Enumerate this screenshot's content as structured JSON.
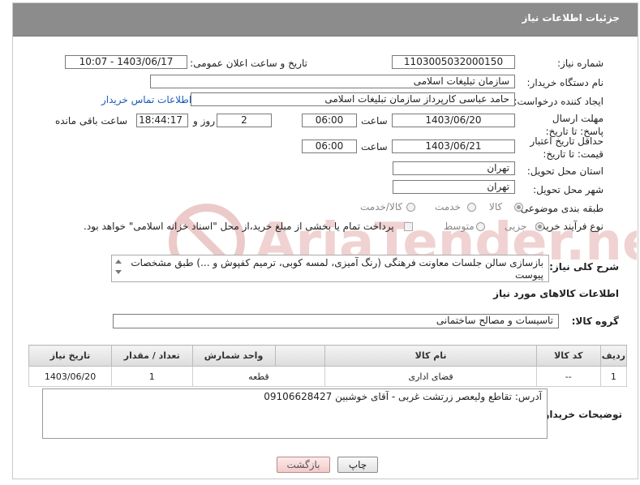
{
  "header": {
    "title": "جزئیات اطلاعات نیاز"
  },
  "fields": {
    "need_number_label": "شماره نیاز:",
    "need_number": "1103005032000150",
    "announce_label": "تاریخ و ساعت اعلان عمومی:",
    "announce_value": "1403/06/17 - 10:07",
    "buyer_org_label": "نام دستگاه خریدار:",
    "buyer_org": "سازمان تبلیغات اسلامی",
    "requester_label": "ایجاد کننده درخواست:",
    "requester": "حامد عباسی کارپرداز سازمان تبلیغات اسلامی",
    "contact_link": "اطلاعات تماس خریدار",
    "deadline_label": "مهلت ارسال پاسخ: تا تاریخ:",
    "deadline_date": "1403/06/20",
    "time_label": "ساعت",
    "deadline_time": "06:00",
    "days_value": "2",
    "days_label": "روز و",
    "remaining_time": "18:44:17",
    "remaining_label": "ساعت باقی مانده",
    "validity_label": "حداقل تاریخ اعتبار قیمت: تا تاریخ:",
    "validity_date": "1403/06/21",
    "validity_time": "06:00",
    "province_label": "استان محل تحویل:",
    "province": "تهران",
    "city_label": "شهر محل تحویل:",
    "city": "تهران",
    "category_label": "طبقه بندی موضوعی:",
    "category_options": [
      "کالا",
      "خدمت",
      "کالا/خدمت"
    ],
    "process_label": "نوع فرآیند خرید :",
    "process_options": [
      "جزیی",
      "متوسط"
    ],
    "payment_note": "پرداخت تمام یا بخشی از مبلغ خرید،از محل \"اسناد خزانه اسلامی\" خواهد بود.",
    "description_label": "شرح کلی نیاز:",
    "description": "بازسازی سالن جلسات معاونت فرهنگی (رنگ آمیزی، لمسه کوبی، ترمیم کفپوش و ...) طبق مشخصات پیوست",
    "goods_info_title": "اطلاعات کالاهای مورد نیاز",
    "goods_group_label": "گروه کالا:",
    "goods_group": "تاسیسات و مصالح ساختمانی",
    "buyer_notes_label": "توضیحات خریدار:",
    "buyer_notes": "آدرس: تقاطع ولیعصر زرتشت غربی - آقای خوشبین 09106628427"
  },
  "table": {
    "headers": [
      "ردیف",
      "کد کالا",
      "نام کالا",
      "واحد شمارش",
      "تعداد / مقدار",
      "تاریخ نیاز"
    ],
    "rows": [
      [
        "1",
        "--",
        "فضای اداری",
        "قطعه",
        "1",
        "1403/06/20"
      ]
    ]
  },
  "buttons": {
    "print": "چاپ",
    "back": "بازگشت"
  },
  "watermark": {
    "text": "AriaTender.net"
  },
  "colors": {
    "header_bg": "#8c8c8c",
    "link": "#1a5ab8",
    "watermark": "#e8b9b9"
  }
}
